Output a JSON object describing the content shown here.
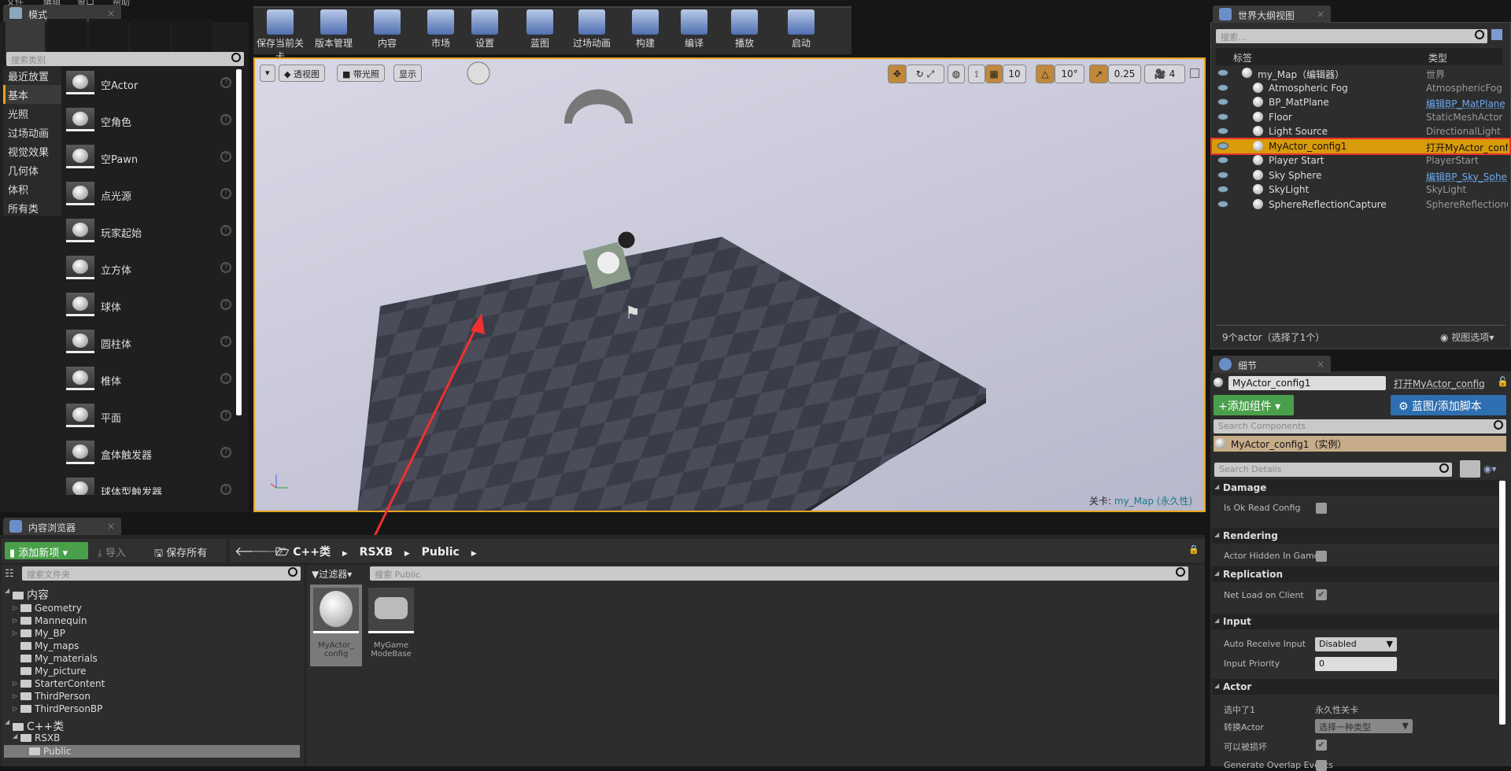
{
  "menu": [
    "文件",
    "编辑",
    "窗口",
    "帮助"
  ],
  "modes": {
    "tab": "模式",
    "search_placeholder": "搜索类别",
    "categories": [
      "最近放置",
      "基本",
      "光照",
      "过场动画",
      "视觉效果",
      "几何体",
      "体积",
      "所有类"
    ],
    "selected_category": "基本",
    "items": [
      "空Actor",
      "空角色",
      "空Pawn",
      "点光源",
      "玩家起始",
      "立方体",
      "球体",
      "圆柱体",
      "椎体",
      "平面",
      "盒体触发器",
      "球体型触发器"
    ]
  },
  "toolbar": {
    "buttons": [
      "保存当前关卡",
      "版本管理",
      "内容",
      "市场",
      "设置",
      "蓝图",
      "过场动画",
      "构建",
      "编译",
      "播放",
      "启动"
    ]
  },
  "viewport": {
    "menu_buttons": [
      "透视图",
      "带光照",
      "显示"
    ],
    "grid_snap": "10",
    "rotation_snap": "10°",
    "scale_snap": "0.25",
    "camera_speed": "4",
    "level_label": "关卡:",
    "level_name": "my_Map (永久性)",
    "accent": "#e8a21b"
  },
  "outliner": {
    "tab": "世界大纲视图",
    "search_placeholder": "搜索...",
    "col_label": "标签",
    "col_type": "类型",
    "rows": [
      {
        "name": "my_Map（编辑器）",
        "type": "世界"
      },
      {
        "name": "Atmospheric Fog",
        "type": "AtmosphericFog"
      },
      {
        "name": "BP_MatPlane",
        "type": "编辑BP_MatPlane"
      },
      {
        "name": "Floor",
        "type": "StaticMeshActor"
      },
      {
        "name": "Light Source",
        "type": "DirectionalLight"
      },
      {
        "name": "MyActor_config1",
        "type": "打开MyActor_config"
      },
      {
        "name": "Player Start",
        "type": "PlayerStart"
      },
      {
        "name": "Sky Sphere",
        "type": "编辑BP_Sky_Sphere"
      },
      {
        "name": "SkyLight",
        "type": "SkyLight"
      },
      {
        "name": "SphereReflectionCapture",
        "type": "SphereReflectionCapture"
      }
    ],
    "selected": "MyActor_config1",
    "status": "9个actor（选择了1个）",
    "view_options": "视图选项",
    "selection_color": "#d89b0a"
  },
  "details": {
    "tab": "细节",
    "name_value": "MyActor_config1",
    "open_link": "打开MyActor_config",
    "add_component": "添加组件",
    "blueprint_button": "蓝图/添加脚本",
    "search_components_placeholder": "Search Components",
    "component_instance": "MyActor_config1（实例）",
    "search_details_placeholder": "Search Details",
    "sections": {
      "damage": "Damage",
      "rendering": "Rendering",
      "replication": "Replication",
      "input": "Input",
      "actor": "Actor"
    },
    "props": {
      "is_ok_read_config": "Is Ok Read Config",
      "actor_hidden": "Actor Hidden In Game",
      "net_load": "Net Load on Client",
      "auto_receive": "Auto Receive Input",
      "auto_receive_value": "Disabled",
      "input_priority": "Input Priority",
      "input_priority_value": "0",
      "selected": "选中了1",
      "selected_value": "永久性关卡",
      "convert": "转换Actor",
      "convert_value": "选择一种类型",
      "can_be_damaged": "可以被损坏",
      "generate_overlap": "Generate Overlap Events"
    },
    "checks": {
      "is_ok_read_config": false,
      "actor_hidden": false,
      "net_load": true,
      "can_be_damaged": true
    }
  },
  "content": {
    "tab": "内容浏览器",
    "add_new": "添加新项",
    "import": "导入",
    "save_all": "保存所有",
    "path": [
      "C++类",
      "RSXB",
      "Public"
    ],
    "folder_search_placeholder": "搜索文件夹",
    "filter": "过滤器",
    "asset_search_placeholder": "搜索 Public",
    "tree_root": "内容",
    "folders": [
      "Geometry",
      "Mannequin",
      "My_BP",
      "My_maps",
      "My_materials",
      "My_picture",
      "StarterContent",
      "ThirdPerson",
      "ThirdPersonBP"
    ],
    "cpp_root": "C++类",
    "cpp_module": "RSXB",
    "cpp_selected": "Public",
    "assets": [
      {
        "line1": "MyActor_",
        "line2": "config"
      },
      {
        "line1": "MyGame",
        "line2": "ModeBase"
      }
    ]
  }
}
